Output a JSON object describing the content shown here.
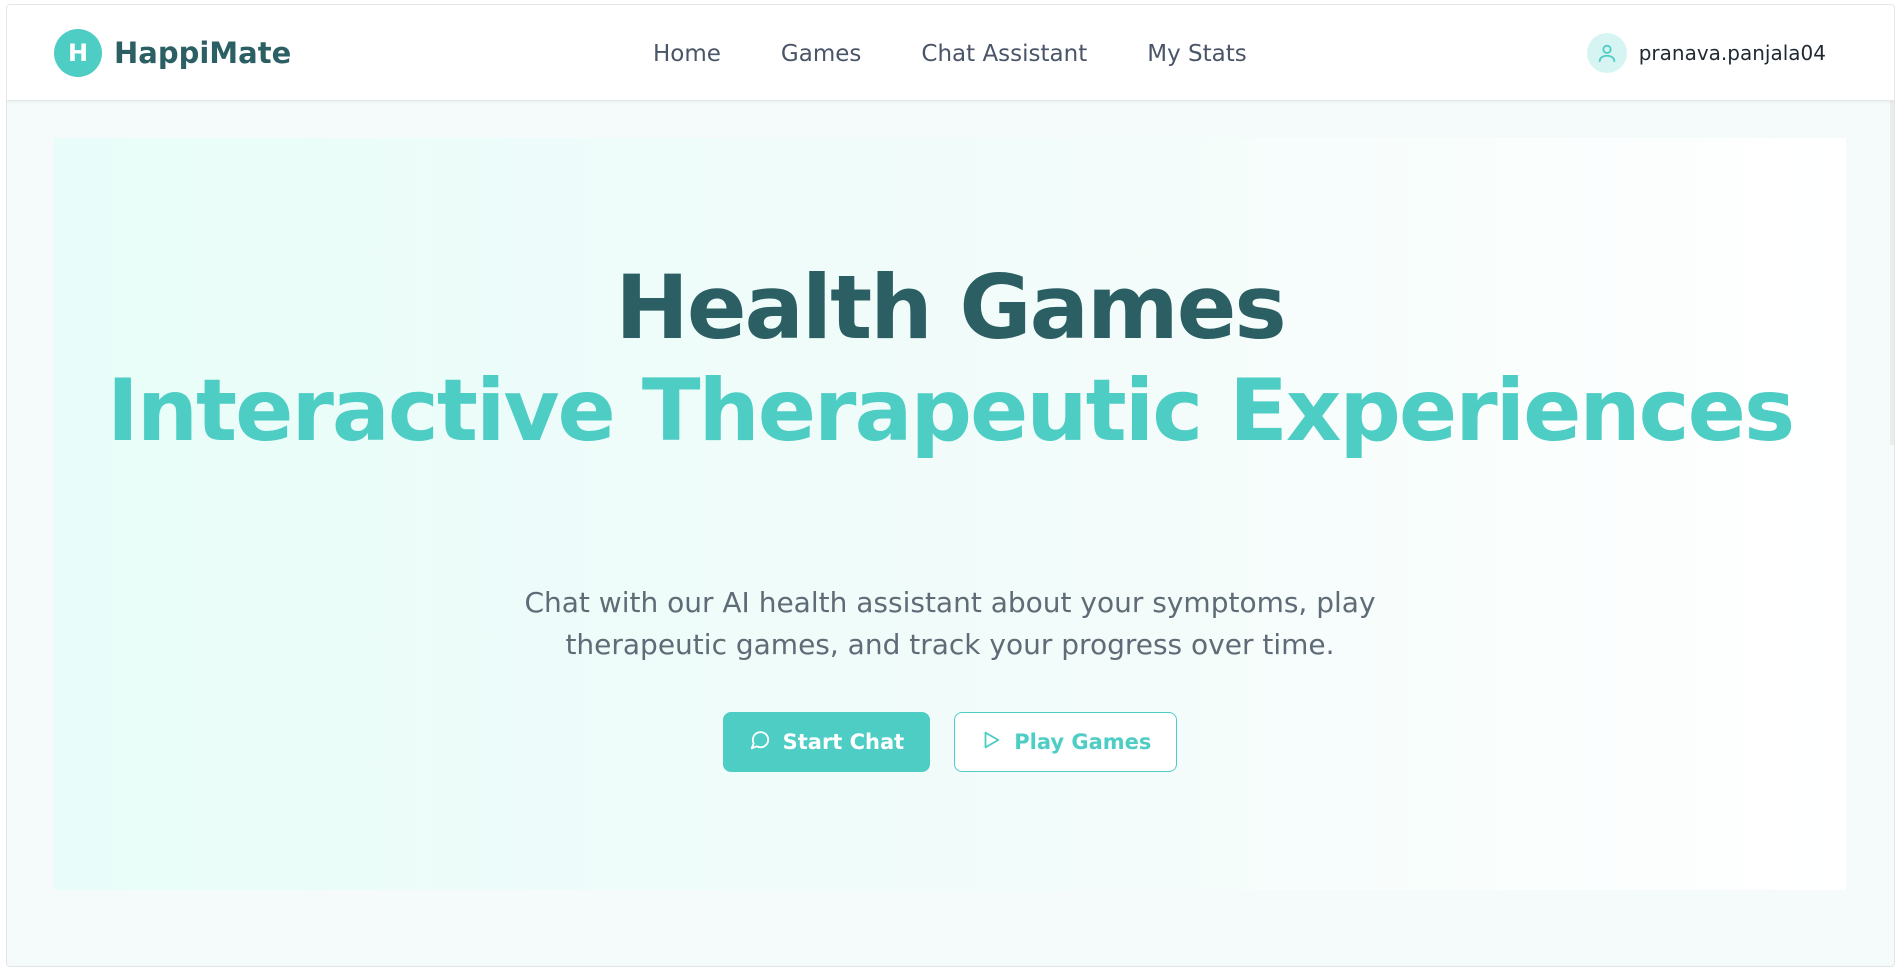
{
  "brand": {
    "logo_letter": "H",
    "name": "HappiMate"
  },
  "nav": {
    "items": [
      "Home",
      "Games",
      "Chat Assistant",
      "My Stats"
    ]
  },
  "user": {
    "icon": "user-icon",
    "username": "pranava.panjala04"
  },
  "hero": {
    "title": "Health Games",
    "subtitle": "Interactive Therapeutic Experiences",
    "description": "Chat with our AI health assistant about your symptoms, play therapeutic games, and track your progress over time.",
    "primary_button": {
      "label": "Start Chat",
      "icon": "chat-bubble-icon"
    },
    "secondary_button": {
      "label": "Play Games",
      "icon": "play-icon"
    }
  },
  "colors": {
    "accent": "#4ecdc4",
    "brand_dark": "#2b5f63",
    "text_muted": "#5f6b76"
  }
}
